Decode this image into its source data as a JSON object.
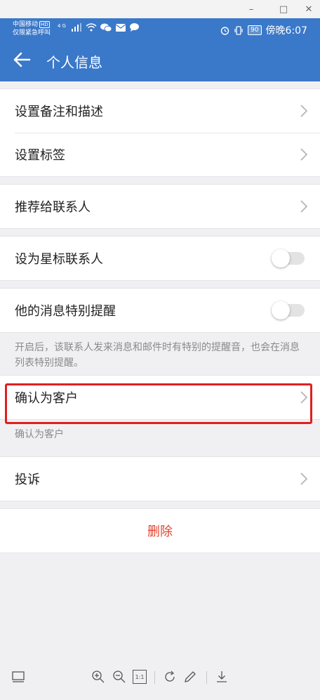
{
  "window": {
    "minimize": "–",
    "maximize": "□",
    "close": "✕"
  },
  "status_bar": {
    "carrier_line1": "中国移动",
    "hd_badge": "HD",
    "carrier_line2": "仅限紧急呼叫",
    "network": "4G",
    "battery": "90",
    "time": "傍晚6:07"
  },
  "app_bar": {
    "title": "个人信息"
  },
  "groups": [
    {
      "rows": [
        {
          "label": "设置备注和描述",
          "control": "chevron"
        },
        {
          "label": "设置标签",
          "control": "chevron"
        }
      ]
    },
    {
      "rows": [
        {
          "label": "推荐给联系人",
          "control": "chevron"
        }
      ]
    },
    {
      "rows": [
        {
          "label": "设为星标联系人",
          "control": "toggle",
          "on": false
        }
      ]
    },
    {
      "rows": [
        {
          "label": "他的消息特别提醒",
          "control": "toggle",
          "on": false
        }
      ]
    }
  ],
  "special_note": "开启后，该联系人发来消息和邮件时有特别的提醒音，也会在消息列表特别提醒。",
  "confirm_row": {
    "label": "确认为客户"
  },
  "confirm_note": "确认为客户",
  "complain_row": {
    "label": "投诉"
  },
  "delete_label": "删除",
  "colors": {
    "primary": "#3a78c9",
    "danger": "#e0442e",
    "highlight": "#e02020"
  },
  "viewer_toolbar": [
    "thumbnail-icon",
    "zoom-in-icon",
    "zoom-out-icon",
    "actual-size-icon",
    "rotate-icon",
    "edit-icon",
    "download-icon"
  ],
  "actual_size_label": "1:1"
}
